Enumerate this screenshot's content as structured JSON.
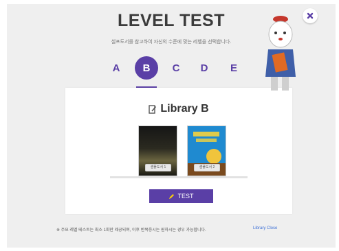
{
  "title": "LEVEL TEST",
  "subtitle": "셀프도서를 참고하여 자신의 수준에 맞는 레벨을 선택합니다.",
  "tabs": [
    {
      "label": "A",
      "active": false
    },
    {
      "label": "B",
      "active": true
    },
    {
      "label": "C",
      "active": false
    },
    {
      "label": "D",
      "active": false
    },
    {
      "label": "E",
      "active": false
    }
  ],
  "card": {
    "title": "Library B",
    "books": [
      {
        "tag": "샘플도서 1"
      },
      {
        "tag": "샘플도서 2"
      }
    ],
    "test_button": "TEST"
  },
  "footer": {
    "note": "※ 주요 레벨 테스트는 최소 1회만 제공되며, 이후 반복응시는 원하시는 경우 가능합니다.",
    "link": "Library Close"
  },
  "colors": {
    "accent": "#5a3fa6",
    "background": "#efefef"
  },
  "icons": {
    "close": "close-x-icon",
    "card_title": "book-pen-icon",
    "test": "pencil-icon"
  }
}
